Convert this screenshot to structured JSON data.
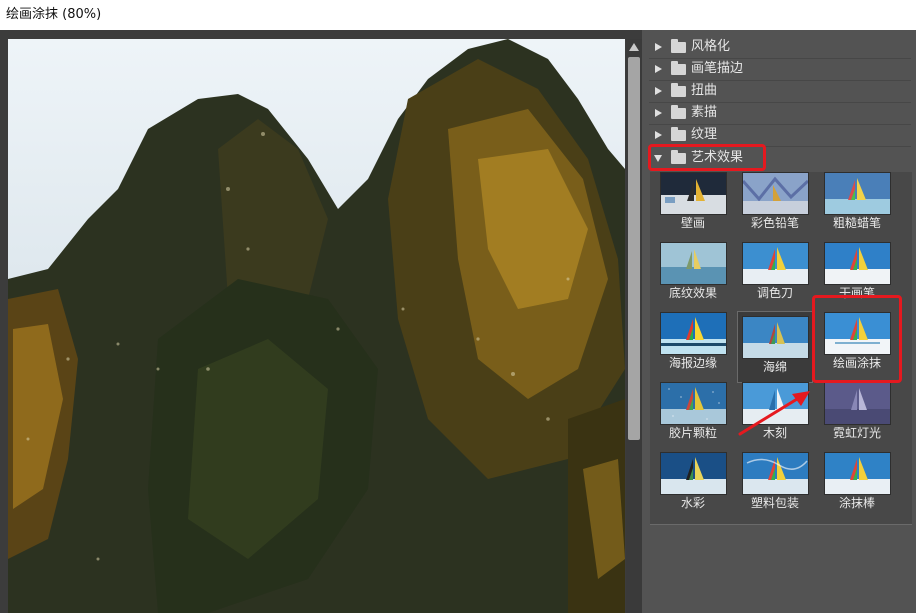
{
  "window": {
    "title": "绘画涂抹 (80%)"
  },
  "categories": [
    {
      "label": "风格化",
      "expanded": false
    },
    {
      "label": "画笔描边",
      "expanded": false
    },
    {
      "label": "扭曲",
      "expanded": false
    },
    {
      "label": "素描",
      "expanded": false
    },
    {
      "label": "纹理",
      "expanded": false
    },
    {
      "label": "艺术效果",
      "expanded": true
    }
  ],
  "filters": [
    {
      "label": "壁画"
    },
    {
      "label": "彩色铅笔"
    },
    {
      "label": "粗糙蜡笔"
    },
    {
      "label": "底纹效果"
    },
    {
      "label": "调色刀"
    },
    {
      "label": "干画笔"
    },
    {
      "label": "海报边缘"
    },
    {
      "label": "海绵"
    },
    {
      "label": "绘画涂抹"
    },
    {
      "label": "胶片颗粒"
    },
    {
      "label": "木刻"
    },
    {
      "label": "霓虹灯光"
    },
    {
      "label": "水彩"
    },
    {
      "label": "塑料包装"
    },
    {
      "label": "涂抹棒"
    }
  ],
  "selected_filter": "绘画涂抹",
  "colors": {
    "highlight": "#e5191f",
    "panel_bg": "#535353",
    "gallery_bg": "#484848"
  }
}
